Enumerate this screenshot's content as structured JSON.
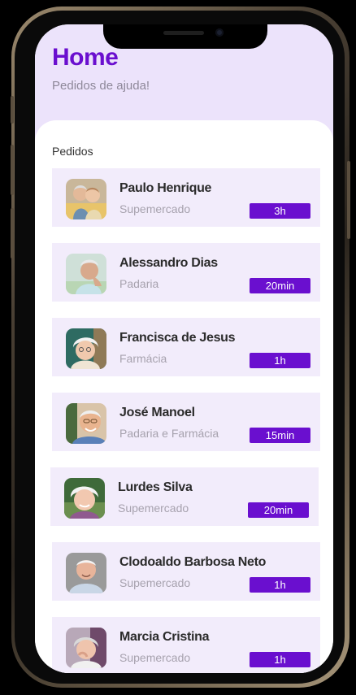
{
  "header": {
    "title": "Home",
    "subtitle": "Pedidos de ajuda!"
  },
  "section": {
    "label": "Pedidos"
  },
  "requests": [
    {
      "name": "Paulo Henrique",
      "category": "Supemercado",
      "time": "3h"
    },
    {
      "name": "Alessandro Dias",
      "category": "Padaria",
      "time": "20min"
    },
    {
      "name": "Francisca de Jesus",
      "category": "Farmácia",
      "time": "1h"
    },
    {
      "name": "José Manoel",
      "category": "Padaria e Farmácia",
      "time": "15min"
    },
    {
      "name": "Lurdes Silva",
      "category": "Supemercado",
      "time": "20min"
    },
    {
      "name": "Clodoaldo Barbosa Neto",
      "category": "Supemercado",
      "time": "1h"
    },
    {
      "name": "Marcia Cristina",
      "category": "Supemercado",
      "time": "1h"
    }
  ],
  "colors": {
    "accent": "#6a0fcf",
    "header_bg": "#ece3fb",
    "card_bg": "#f2ecfb",
    "muted_text": "#a7a2ae"
  },
  "icons": {
    "avatar": "person-photo-icon"
  }
}
